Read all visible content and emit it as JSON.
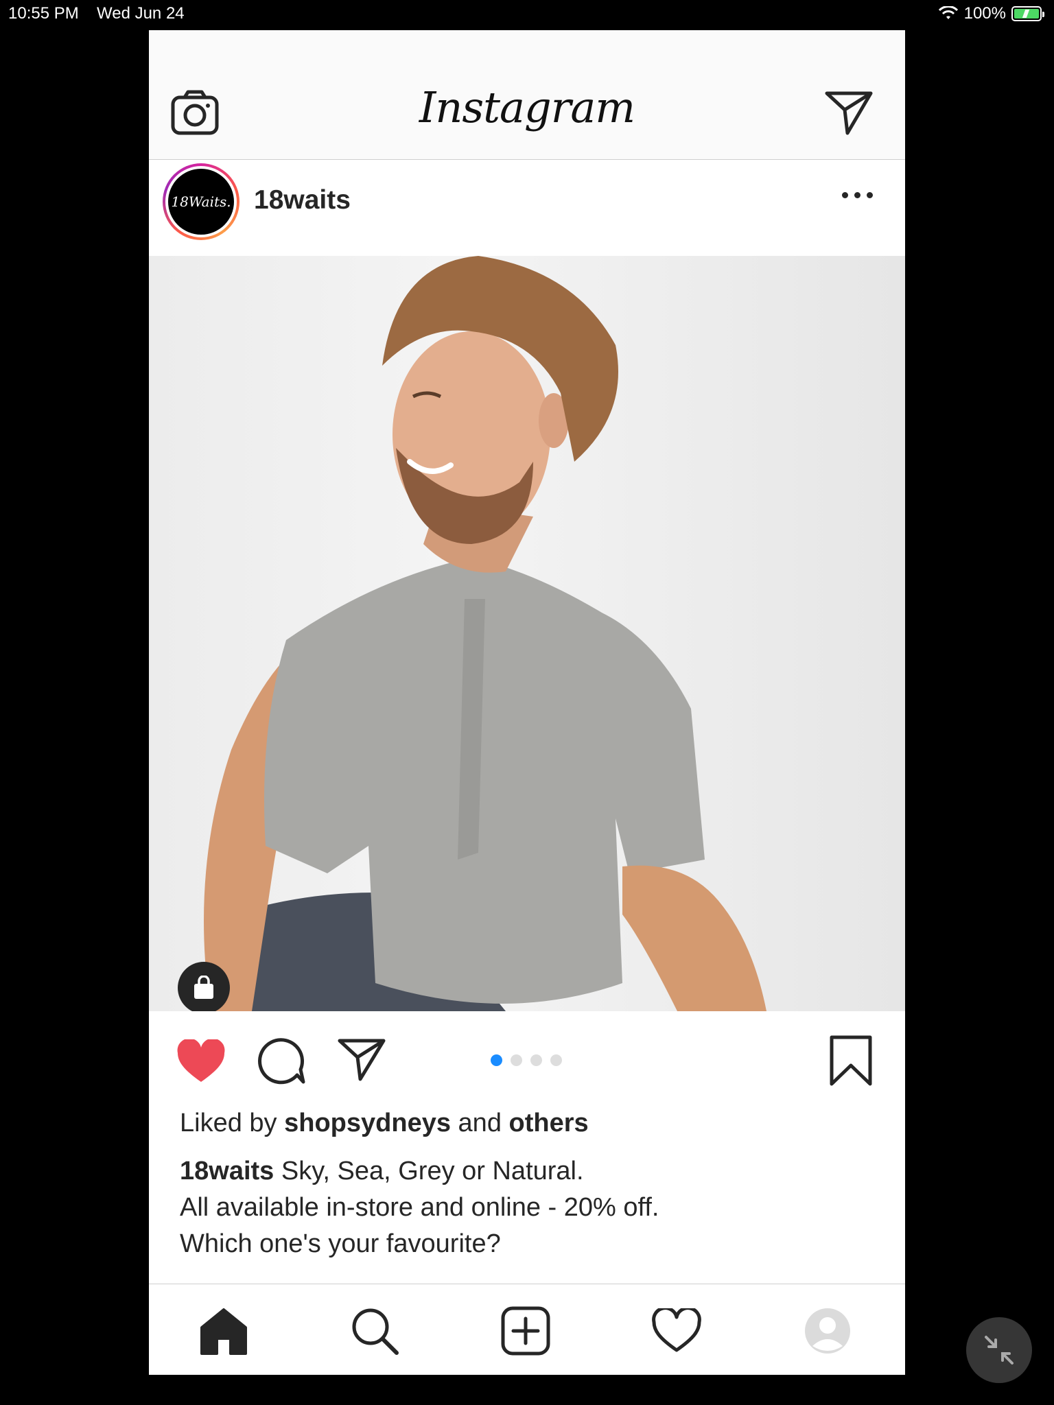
{
  "status_bar": {
    "time": "10:55 PM",
    "date": "Wed Jun 24",
    "battery": "100%",
    "icons": [
      "wifi-icon",
      "battery-charging-icon"
    ]
  },
  "app": {
    "logo": "Instagram",
    "header_icons": {
      "left": "camera-icon",
      "right": "direct-message-icon"
    }
  },
  "post": {
    "username": "18waits",
    "avatar_text": "18Waits.",
    "more_icon": "more-options-icon",
    "shop_icon": "shopping-bag-icon",
    "carousel": {
      "count": 4,
      "active_index": 0
    },
    "likes": {
      "prefix": "Liked by",
      "user": "shopsydneys",
      "middle": "and",
      "suffix": "others"
    },
    "caption": {
      "user": "18waits",
      "line1": " Sky, Sea, Grey or Natural.",
      "line2": "All available in-store and online - 20% off.",
      "line3": "Which one's your favourite?"
    },
    "actions": [
      "heart-liked-icon",
      "comment-icon",
      "share-icon",
      "bookmark-icon"
    ]
  },
  "tab_bar": {
    "items": [
      "home-icon",
      "search-icon",
      "add-post-icon",
      "activity-heart-icon",
      "profile-avatar-icon"
    ]
  },
  "colors": {
    "like_red": "#ed4956",
    "carousel_active": "#1a8cff",
    "text": "#262626"
  },
  "overlay": {
    "shrink_icon": "shrink-window-icon"
  }
}
